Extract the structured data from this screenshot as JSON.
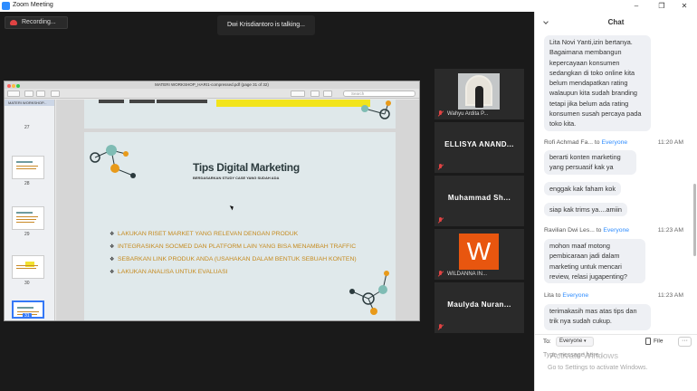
{
  "window": {
    "title": "Zoom Meeting",
    "controls": [
      "–",
      "❐",
      "✕"
    ]
  },
  "recording": {
    "label": "Recording..."
  },
  "talking": "Dwi Krisdiantoro is talking...",
  "pdf": {
    "title": "MATERI WORKSHOP_HARI1-compressed.pdf (page 31 of 32)",
    "search_placeholder": "Search",
    "sidebar_header": "MATERI WORKSHOP...",
    "pages": [
      "27",
      "28",
      "29",
      "30",
      "31"
    ],
    "selected_page": "31"
  },
  "slide": {
    "title": "Tips Digital Marketing",
    "subtitle": "BERDASARKAN STUDY CASE YANG SUDAH ADA",
    "bullets": [
      "LAKUKAN RISET MARKET YANG RELEVAN DENGAN PRODUK",
      "INTEGRASIKAN SOCMED DAN PLATFORM LAIN YANG BISA MENAMBAH TRAFFIC",
      "SEBARKAN LINK PRODUK ANDA (USAHAKAN DALAM BENTUK SEBUAH KONTEN)",
      "LAKUKAN ANALISA UNTUK EVALUASI"
    ]
  },
  "participants": [
    {
      "name": "Wahyu Ardita P..."
    },
    {
      "name": "ELLISYA ANAND..."
    },
    {
      "name": "Muhammad Sh..."
    },
    {
      "name": "WILDANNA IN...",
      "avatar_letter": "W",
      "avatar_color": "#e8560f"
    },
    {
      "name": "Maulyda Nuran..."
    }
  ],
  "chat": {
    "title": "Chat",
    "messages": [
      {
        "text": "Lita Novi Yanti,izin bertanya. Bagaimana membangun kepercayaan konsumen sedangkan di toko online kita belum mendapatkan rating walaupun kita sudah branding tetapi jika belum ada rating konsumen susah percaya pada toko kita."
      },
      {
        "from": "Rofi Achmad Fa...",
        "to": "Everyone",
        "time": "11:20 AM"
      },
      {
        "text": "berarti konten marketing yang persuasif kak ya"
      },
      {
        "text": "enggak kak faham kok"
      },
      {
        "text": "siap kak trims ya....amiin"
      },
      {
        "from": "Ravilian Dwi Les...",
        "to": "Everyone",
        "time": "11:23 AM"
      },
      {
        "text": "mohon maaf motong pembicaraan jadi dalam marketing untuk mencari review, relasi jugapenting?"
      },
      {
        "from": "Lita",
        "to": "Everyone",
        "time": "11:23 AM"
      },
      {
        "text": "terimakasih mas atas tips dan trik nya sudah cukup."
      }
    ],
    "to_label": "To:",
    "to_value": "Everyone",
    "file_label": "File",
    "more_label": "···",
    "input_placeholder": "Type message here...",
    "watermark_title": "Activate Windows",
    "watermark_sub": "Go to Settings to activate Windows."
  },
  "colors": {
    "accent": "#2d8cff",
    "mute": "#e04343",
    "slide_text": "#c58a1e"
  }
}
